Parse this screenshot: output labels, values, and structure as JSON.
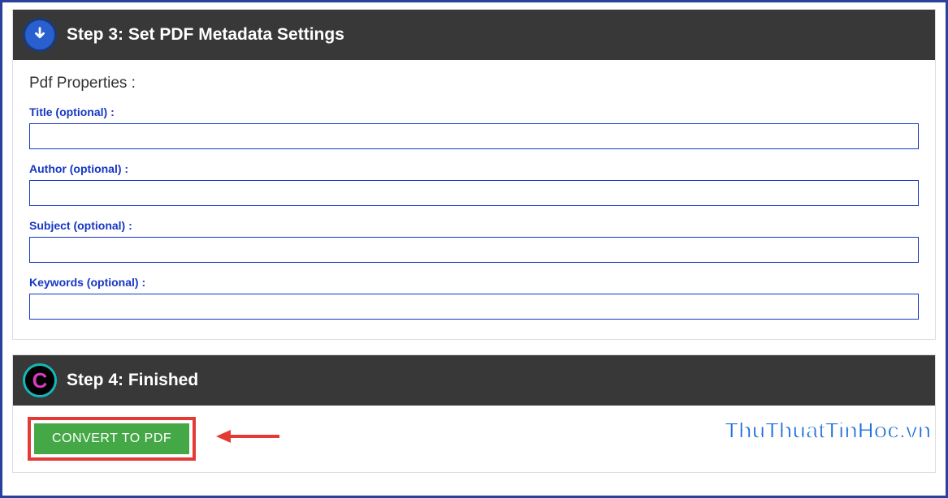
{
  "step3": {
    "header": "Step 3: Set PDF Metadata Settings",
    "section_title": "Pdf Properties :",
    "fields": {
      "title": {
        "label": "Title (optional) :",
        "value": ""
      },
      "author": {
        "label": "Author (optional) :",
        "value": ""
      },
      "subject": {
        "label": "Subject (optional) :",
        "value": ""
      },
      "keywords": {
        "label": "Keywords (optional) :",
        "value": ""
      }
    }
  },
  "step4": {
    "header": "Step 4: Finished",
    "convert_label": "CONVERT TO PDF"
  },
  "watermark": "ThuThuatTinHoc.vn"
}
